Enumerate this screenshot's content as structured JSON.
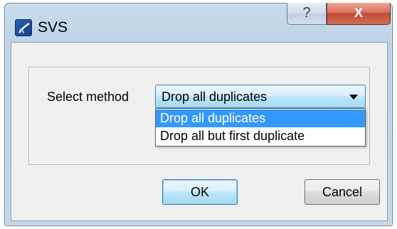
{
  "window": {
    "title": "SVS",
    "icon": "svs-app-icon"
  },
  "titlebar_buttons": {
    "help_label": "?",
    "close_label": "X"
  },
  "form": {
    "select_label": "Select method",
    "combo_value": "Drop all duplicates",
    "options": [
      "Drop all duplicates",
      "Drop all but first duplicate"
    ],
    "highlighted_option_index": 0
  },
  "buttons": {
    "ok_label": "OK",
    "cancel_label": "Cancel"
  },
  "colors": {
    "selection": "#3399ff",
    "close_button": "#c24a34",
    "focus_border": "#3c7fb1"
  }
}
